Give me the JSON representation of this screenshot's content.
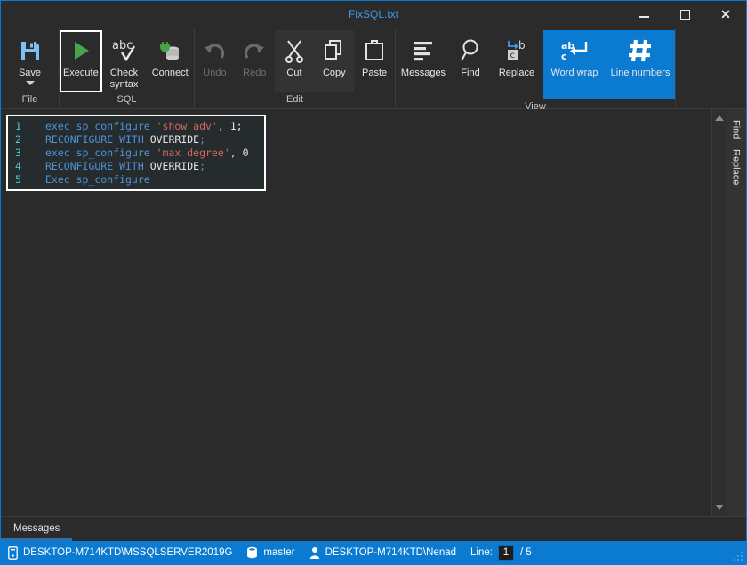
{
  "window": {
    "title": "FixSQL.txt",
    "accent_color": "#0b7ad1",
    "controls": {
      "minimize": "–",
      "maximize": "□",
      "close": "✕"
    }
  },
  "ribbon": {
    "groups": [
      {
        "label": "File",
        "buttons": [
          {
            "name": "save",
            "label": "Save",
            "icon": "floppy-disk-icon",
            "state": "normal",
            "has_dropdown": true
          }
        ]
      },
      {
        "label": "SQL",
        "buttons": [
          {
            "name": "execute",
            "label": "Execute",
            "icon": "play-triangle-icon",
            "state": "focused"
          },
          {
            "name": "check-syntax",
            "label": "Check syntax",
            "icon": "abc-checkmark-icon",
            "state": "normal"
          },
          {
            "name": "connect",
            "label": "Connect",
            "icon": "database-plug-icon",
            "state": "normal"
          }
        ]
      },
      {
        "label": "Edit",
        "buttons": [
          {
            "name": "undo",
            "label": "Undo",
            "icon": "undo-arrow-icon",
            "state": "disabled"
          },
          {
            "name": "redo",
            "label": "Redo",
            "icon": "redo-arrow-icon",
            "state": "disabled"
          },
          {
            "name": "cut",
            "label": "Cut",
            "icon": "scissors-icon",
            "state": "boxed"
          },
          {
            "name": "copy",
            "label": "Copy",
            "icon": "copy-pages-icon",
            "state": "boxed"
          },
          {
            "name": "paste",
            "label": "Paste",
            "icon": "clipboard-icon",
            "state": "normal"
          }
        ]
      },
      {
        "label": "View",
        "buttons": [
          {
            "name": "messages",
            "label": "Messages",
            "icon": "message-lines-icon",
            "state": "normal"
          },
          {
            "name": "find",
            "label": "Find",
            "icon": "magnifier-icon",
            "state": "normal"
          },
          {
            "name": "replace",
            "label": "Replace",
            "icon": "replace-bc-icon",
            "state": "normal"
          },
          {
            "name": "word-wrap",
            "label": "Word wrap",
            "icon": "word-wrap-icon",
            "state": "active"
          },
          {
            "name": "line-numbers",
            "label": "Line numbers",
            "icon": "hash-grid-icon",
            "state": "active"
          }
        ]
      }
    ]
  },
  "editor": {
    "lines": [
      {
        "number": "1",
        "tokens": [
          {
            "t": "exec sp configure ",
            "c": "kw"
          },
          {
            "t": "'show adv'",
            "c": "str"
          },
          {
            "t": ", ",
            "c": "pl"
          },
          {
            "t": "1",
            "c": "num"
          },
          {
            "t": ";",
            "c": "pl"
          }
        ]
      },
      {
        "number": "2",
        "tokens": [
          {
            "t": "RECONFIGURE WITH ",
            "c": "kw"
          },
          {
            "t": "OVERRIDE",
            "c": "pl"
          },
          {
            "t": ";",
            "c": "kw"
          }
        ]
      },
      {
        "number": "3",
        "tokens": [
          {
            "t": "exec sp_configure ",
            "c": "kw"
          },
          {
            "t": "'max degree'",
            "c": "str"
          },
          {
            "t": ", ",
            "c": "pl"
          },
          {
            "t": "0",
            "c": "num"
          }
        ]
      },
      {
        "number": "4",
        "tokens": [
          {
            "t": "RECONFIGURE WITH ",
            "c": "kw"
          },
          {
            "t": "OVERRIDE",
            "c": "pl"
          },
          {
            "t": ";",
            "c": "kw"
          }
        ]
      },
      {
        "number": "5",
        "tokens": [
          {
            "t": "Exec sp_configure",
            "c": "kw"
          }
        ]
      }
    ],
    "plain_text": "exec sp configure 'show adv', 1;\nRECONFIGURE WITH OVERRIDE;\nexec sp_configure 'max degree', 0\nRECONFIGURE WITH OVERRIDE;\nExec sp_configure"
  },
  "side_tabs": [
    {
      "name": "find",
      "label": "Find"
    },
    {
      "name": "replace",
      "label": "Replace"
    }
  ],
  "messages_panel": {
    "tab_label": "Messages"
  },
  "status_bar": {
    "server": "DESKTOP-M714KTD\\MSSQLSERVER2019G",
    "database": "master",
    "user": "DESKTOP-M714KTD\\Nenad",
    "line_label": "Line:",
    "line_current": "1",
    "line_total": "/ 5"
  }
}
